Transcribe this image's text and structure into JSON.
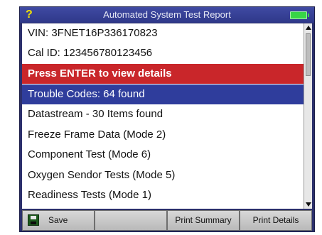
{
  "titlebar": {
    "help_glyph": "?",
    "title": "Automated System Test Report",
    "battery_icon": "battery-icon"
  },
  "list": {
    "items": [
      {
        "label": "VIN: 3FNET16P336170823",
        "state": "normal"
      },
      {
        "label": "Cal ID: 123456780123456",
        "state": "normal"
      },
      {
        "label": "Press ENTER to view details",
        "state": "alert"
      },
      {
        "label": "Trouble Codes: 64 found",
        "state": "selected"
      },
      {
        "label": "Datastream - 30 Items found",
        "state": "normal"
      },
      {
        "label": "Freeze Frame Data (Mode 2)",
        "state": "normal"
      },
      {
        "label": "Component Test (Mode 6)",
        "state": "normal"
      },
      {
        "label": "Oxygen Sendor Tests (Mode 5)",
        "state": "normal"
      },
      {
        "label": "Readiness Tests (Mode 1)",
        "state": "normal"
      }
    ]
  },
  "softkeys": {
    "save": "Save",
    "blank": "",
    "print_summary": "Print Summary",
    "print_details": "Print Details"
  },
  "colors": {
    "frame": "#2b2f6b",
    "alert": "#c9262a",
    "selected": "#2f3d9c",
    "battery": "#38d646",
    "help": "#f2e100"
  }
}
